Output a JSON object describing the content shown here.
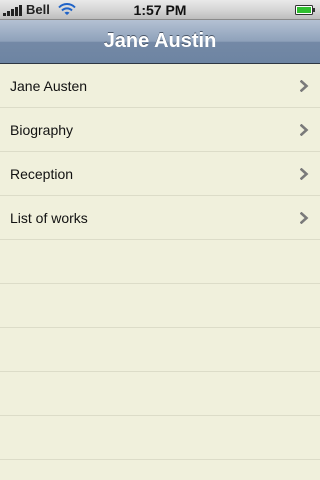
{
  "status_bar": {
    "carrier": "Bell",
    "time": "1:57 PM",
    "icons": [
      "signal-bars-icon",
      "wifi-icon",
      "battery-icon"
    ]
  },
  "nav": {
    "title": "Jane Austin"
  },
  "list": {
    "items": [
      {
        "label": "Jane Austen",
        "accessory": "chevron-right-icon"
      },
      {
        "label": "Biography",
        "accessory": "chevron-right-icon"
      },
      {
        "label": "Reception",
        "accessory": "chevron-right-icon"
      },
      {
        "label": "List of works",
        "accessory": "chevron-right-icon"
      }
    ]
  },
  "colors": {
    "background": "#f0f0dc",
    "separator": "#dcdcc8",
    "nav_bar": "#8ea1ba",
    "chevron": "#7a7a7a",
    "battery": "#2fbf2f"
  }
}
